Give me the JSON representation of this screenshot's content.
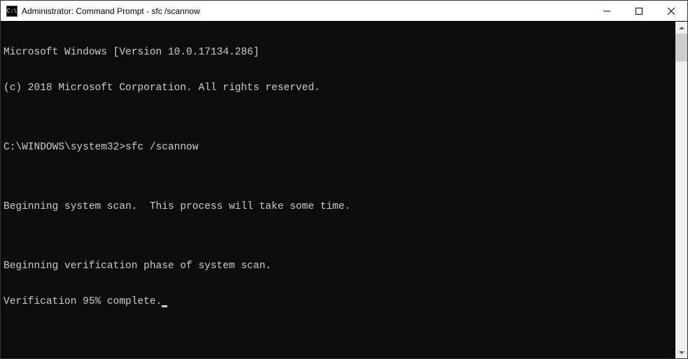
{
  "titlebar": {
    "icon_label": "C:\\",
    "title": "Administrator: Command Prompt - sfc  /scannow"
  },
  "terminal": {
    "lines": [
      "Microsoft Windows [Version 10.0.17134.286]",
      "(c) 2018 Microsoft Corporation. All rights reserved.",
      "",
      "C:\\WINDOWS\\system32>sfc /scannow",
      "",
      "Beginning system scan.  This process will take some time.",
      "",
      "Beginning verification phase of system scan.",
      "Verification 95% complete."
    ]
  }
}
